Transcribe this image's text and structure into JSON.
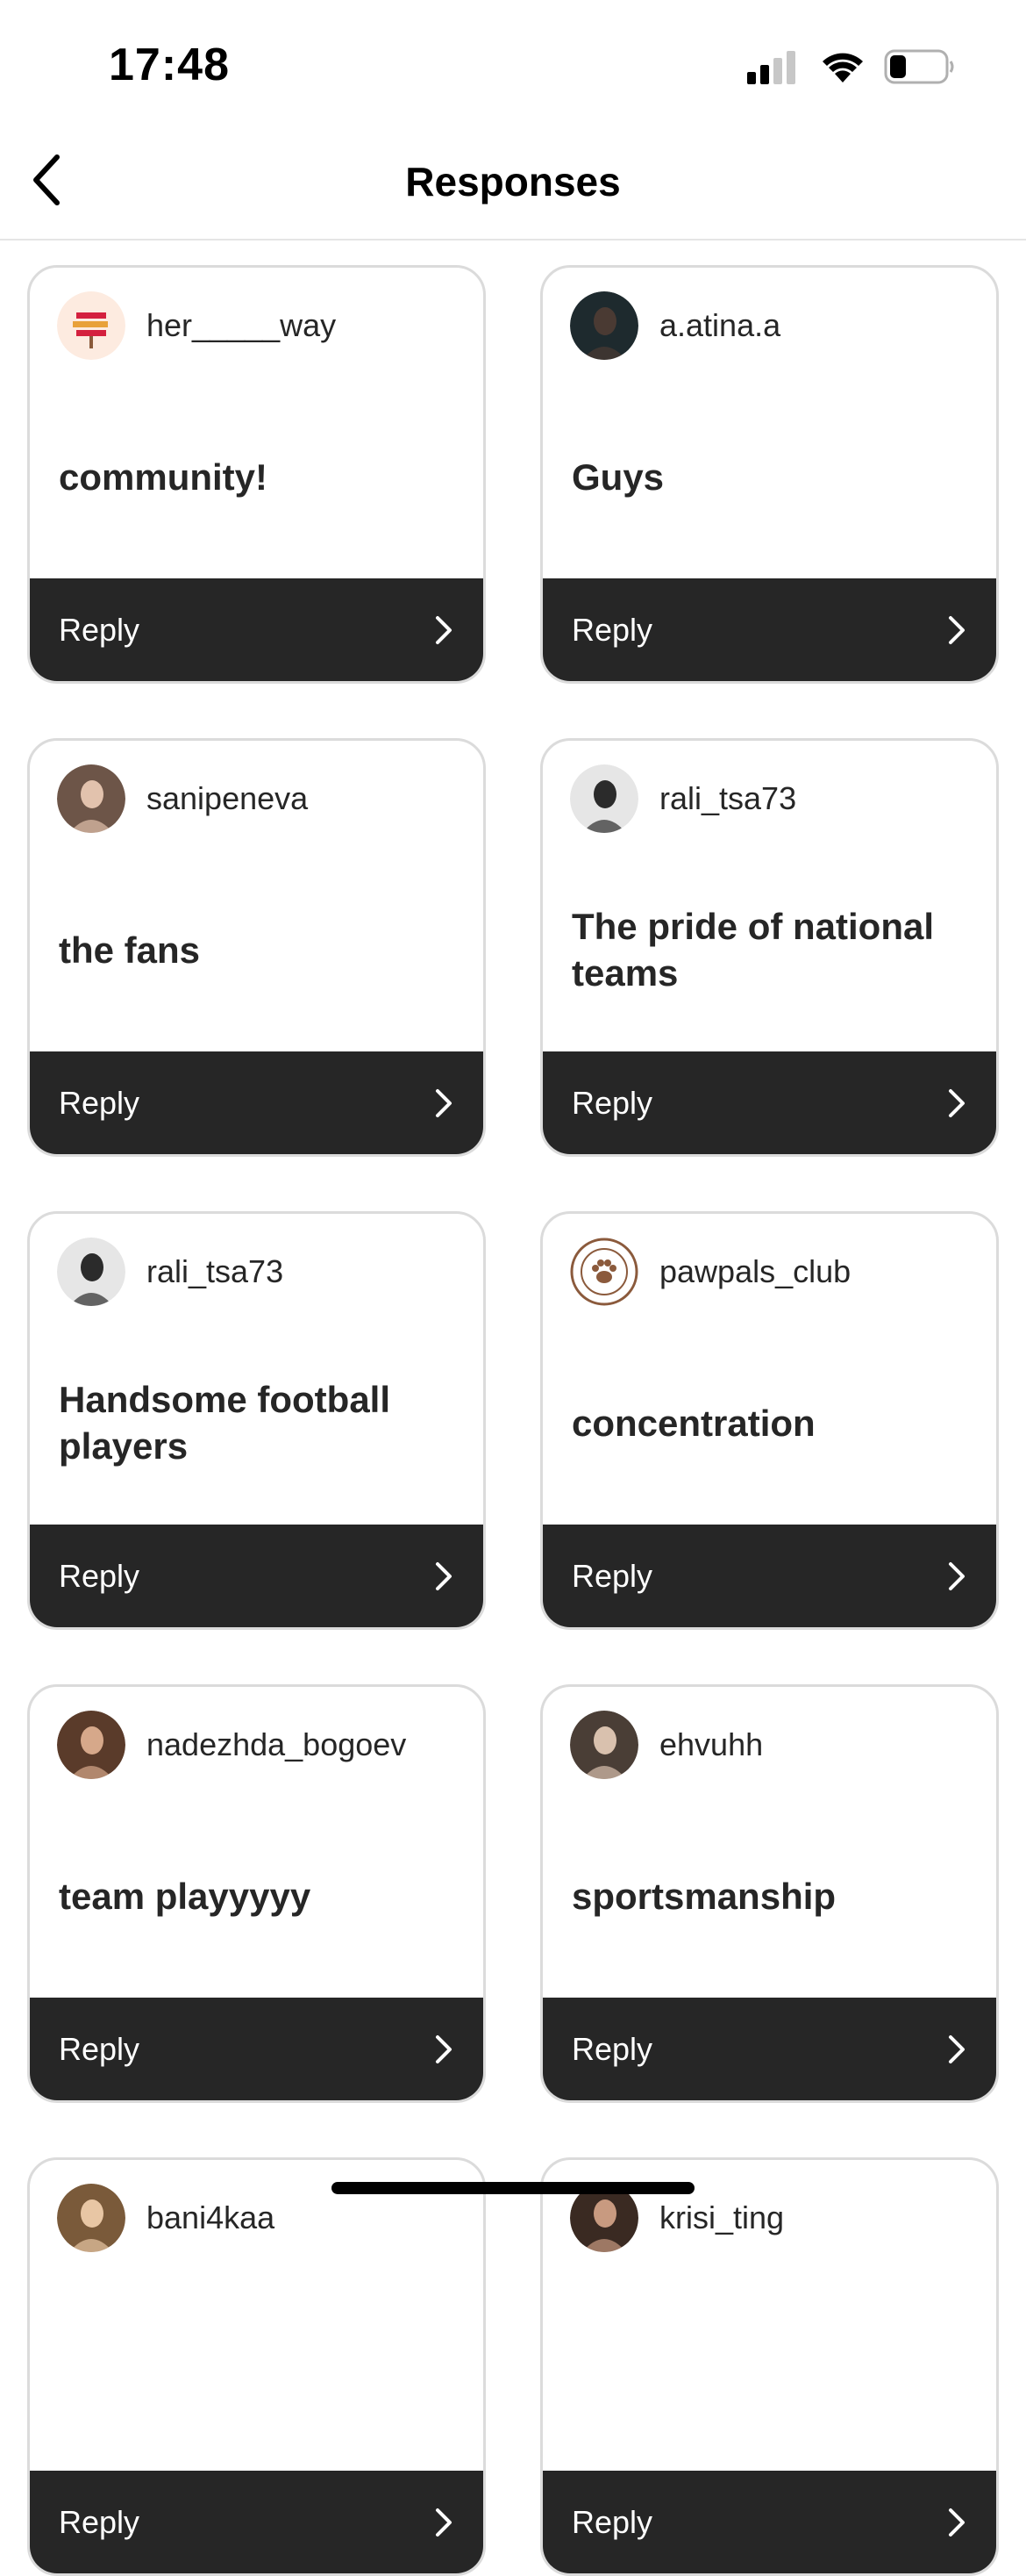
{
  "status_bar": {
    "time": "17:48",
    "battery_level": 0.3
  },
  "nav": {
    "title": "Responses",
    "back_icon": "chevron-left-icon"
  },
  "cards": [
    {
      "username": "her_____way",
      "text": "community!",
      "reply_label": "Reply",
      "avatar": {
        "kind": "her-way-logo",
        "bg": "#fdebe0",
        "accent": "#d4203e"
      }
    },
    {
      "username": "a.atina.a",
      "text": "Guys",
      "reply_label": "Reply",
      "avatar": {
        "kind": "photo",
        "bg": "#1e2a2e",
        "accent": "#4a3a33"
      }
    },
    {
      "username": "sanipeneva",
      "text": "the fans",
      "reply_label": "Reply",
      "avatar": {
        "kind": "photo",
        "bg": "#6d5548",
        "accent": "#e2c2ad"
      }
    },
    {
      "username": "rali_tsa73",
      "text": "The pride of national teams",
      "reply_label": "Reply",
      "avatar": {
        "kind": "photo",
        "bg": "#e6e6e6",
        "accent": "#2b2b2b"
      }
    },
    {
      "username": "rali_tsa73",
      "text": "Handsome football players",
      "reply_label": "Reply",
      "avatar": {
        "kind": "photo",
        "bg": "#e6e6e6",
        "accent": "#2b2b2b"
      }
    },
    {
      "username": "pawpals_club",
      "text": "concentration",
      "reply_label": "Reply",
      "avatar": {
        "kind": "paw-logo",
        "bg": "#ffffff",
        "accent": "#8b5a3c"
      }
    },
    {
      "username": "nadezhda_bogoev",
      "text": "team playyyyy",
      "reply_label": "Reply",
      "avatar": {
        "kind": "photo",
        "bg": "#5a3b2a",
        "accent": "#d6a88a"
      }
    },
    {
      "username": "ehvuhh",
      "text": "sportsmanship",
      "reply_label": "Reply",
      "avatar": {
        "kind": "photo",
        "bg": "#4a3e36",
        "accent": "#d9c1ae"
      }
    },
    {
      "username": "bani4kaa",
      "text": "",
      "reply_label": "Reply",
      "avatar": {
        "kind": "photo",
        "bg": "#7a5a3a",
        "accent": "#e8c6a4"
      }
    },
    {
      "username": "krisi_ting",
      "text": "",
      "reply_label": "Reply",
      "avatar": {
        "kind": "photo",
        "bg": "#3a2a22",
        "accent": "#c89a80"
      }
    }
  ]
}
